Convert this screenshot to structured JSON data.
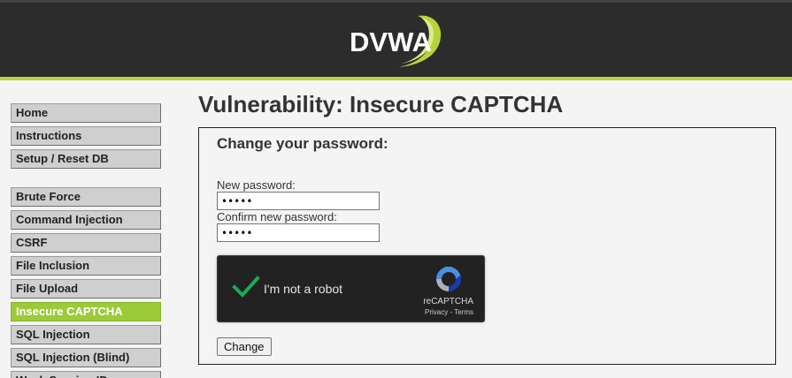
{
  "header": {
    "logo_text": "DVWA"
  },
  "sidebar": {
    "groups": [
      [
        {
          "label": "Home",
          "selected": false
        },
        {
          "label": "Instructions",
          "selected": false
        },
        {
          "label": "Setup / Reset DB",
          "selected": false
        }
      ],
      [
        {
          "label": "Brute Force",
          "selected": false
        },
        {
          "label": "Command Injection",
          "selected": false
        },
        {
          "label": "CSRF",
          "selected": false
        },
        {
          "label": "File Inclusion",
          "selected": false
        },
        {
          "label": "File Upload",
          "selected": false
        },
        {
          "label": "Insecure CAPTCHA",
          "selected": true
        },
        {
          "label": "SQL Injection",
          "selected": false
        },
        {
          "label": "SQL Injection (Blind)",
          "selected": false
        },
        {
          "label": "Weak Session IDs",
          "selected": false
        }
      ]
    ]
  },
  "main": {
    "title": "Vulnerability: Insecure CAPTCHA",
    "form": {
      "heading": "Change your password:",
      "new_password_label": "New password:",
      "new_password_value": "•••••",
      "confirm_password_label": "Confirm new password:",
      "confirm_password_value": "•••••",
      "change_button": "Change"
    },
    "recaptcha": {
      "label": "I'm not a robot",
      "checked": true,
      "brand": "reCAPTCHA",
      "privacy_link": "Privacy",
      "separator": "-",
      "terms_link": "Terms"
    }
  },
  "colors": {
    "header_bg": "#2c2c2c",
    "accent_green": "#b7d33a",
    "selected_nav_bg": "#9bcb3a",
    "checkmark_green": "#1fa855",
    "recaptcha_bg": "#222222"
  },
  "icons": {
    "logo": "dvwa-logo",
    "check": "checkmark-icon",
    "recaptcha": "recaptcha-logo-icon"
  }
}
